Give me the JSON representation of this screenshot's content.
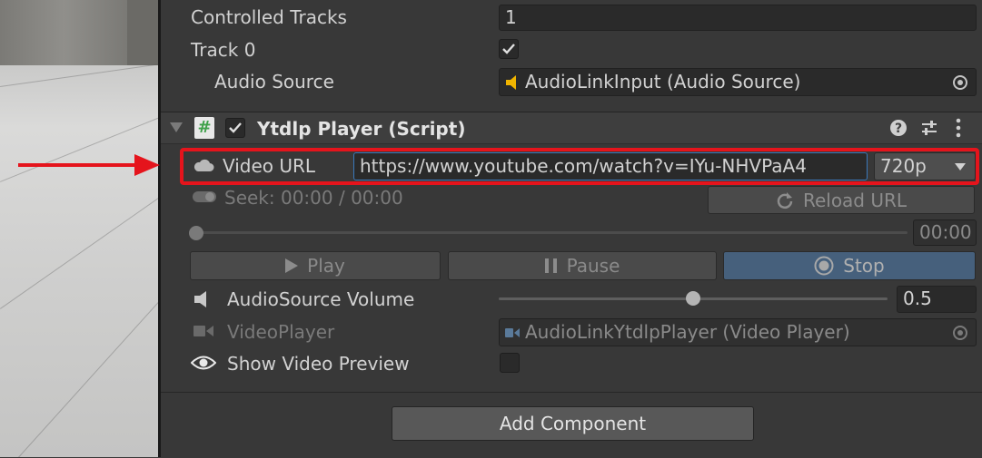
{
  "audiolink": {
    "controlled_tracks_label": "Controlled Tracks",
    "controlled_tracks_value": "1",
    "track0_label": "Track 0",
    "track0_checked": true,
    "audio_source_label": "Audio Source",
    "audio_source_value": "AudioLinkInput (Audio Source)"
  },
  "component": {
    "title": "Ytdlp Player (Script)",
    "enabled": true,
    "script_icon": "hash-script-icon",
    "header_icons": [
      "help-icon",
      "preset-sliders-icon",
      "more-vert-icon"
    ]
  },
  "video": {
    "url_label": "Video URL",
    "url_value": "https://www.youtube.com/watch?v=IYu-NHVPaA4",
    "resolution": "720p",
    "seek_label": "Seek: 00:00 / 00:00",
    "reload_label": "Reload URL",
    "time_value": "00:00",
    "play_label": "Play",
    "pause_label": "Pause",
    "stop_label": "Stop",
    "volume_label": "AudioSource Volume",
    "volume_value": "0.5",
    "volume_level": 0.5,
    "videoplayer_label": "VideoPlayer",
    "videoplayer_value": "AudioLinkYtdlpPlayer (Video Player)",
    "preview_label": "Show Video Preview",
    "preview_checked": false
  },
  "footer": {
    "add_component_label": "Add Component"
  },
  "colors": {
    "highlight": "#e5141c",
    "stop_active": "#46607c",
    "audio_icon": "#f0b400",
    "script_icon": "#3fa14a"
  }
}
